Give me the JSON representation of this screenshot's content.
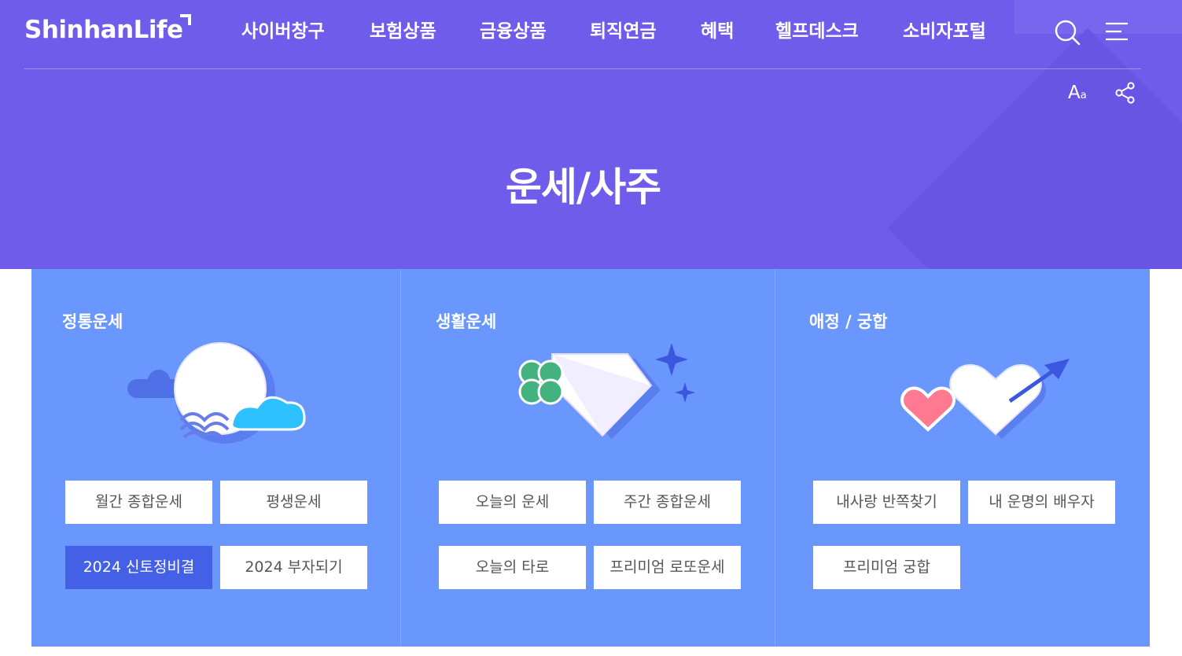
{
  "header": {
    "logo": "ShinhanLife",
    "nav": [
      "사이버창구",
      "보험상품",
      "금융상품",
      "퇴직연금",
      "혜택",
      "헬프데스크",
      "소비자포털"
    ],
    "font_size_label": "A",
    "font_size_small": "a"
  },
  "page": {
    "title": "운세/사주"
  },
  "categories": [
    {
      "title": "정통운세",
      "buttons": [
        "월간 종합운세",
        "평생운세",
        "2024 신토정비결",
        "2024 부자되기"
      ]
    },
    {
      "title": "생활운세",
      "buttons": [
        "오늘의 운세",
        "주간 종합운세",
        "오늘의 타로",
        "프리미엄 로또운세"
      ]
    },
    {
      "title": "애정 / 궁합",
      "buttons": [
        "내사랑 반쪽찾기",
        "내 운명의 배우자",
        "프리미엄 궁합"
      ]
    }
  ],
  "colors": {
    "hero": "#6f5cea",
    "panel": "#6a97fd",
    "active_button": "#4460e6"
  },
  "icons": [
    "search-icon",
    "menu-icon",
    "font-size-icon",
    "share-icon",
    "moon-cloud-illustration",
    "diamond-clover-illustration",
    "hearts-arrow-illustration"
  ]
}
